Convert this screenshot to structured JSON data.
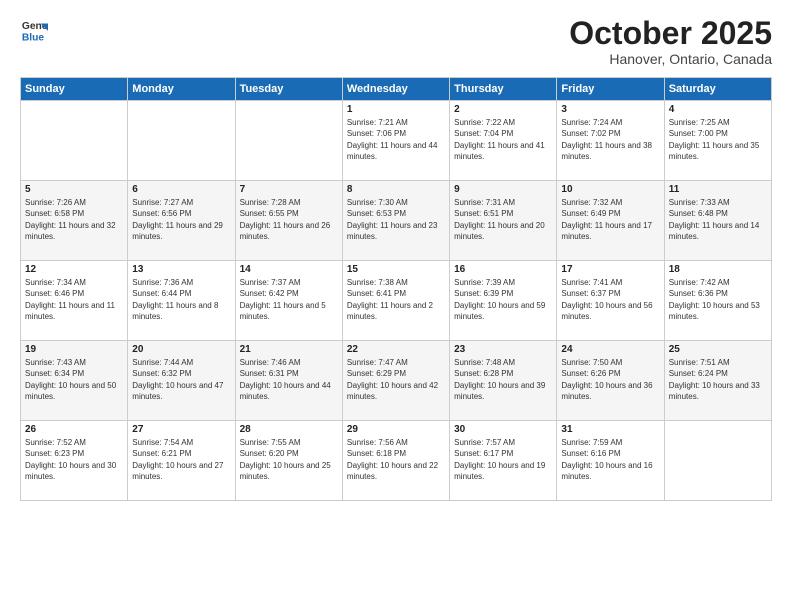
{
  "logo": {
    "line1": "General",
    "line2": "Blue"
  },
  "title": "October 2025",
  "location": "Hanover, Ontario, Canada",
  "days_of_week": [
    "Sunday",
    "Monday",
    "Tuesday",
    "Wednesday",
    "Thursday",
    "Friday",
    "Saturday"
  ],
  "weeks": [
    [
      {
        "day": "",
        "sunrise": "",
        "sunset": "",
        "daylight": ""
      },
      {
        "day": "",
        "sunrise": "",
        "sunset": "",
        "daylight": ""
      },
      {
        "day": "",
        "sunrise": "",
        "sunset": "",
        "daylight": ""
      },
      {
        "day": "1",
        "sunrise": "Sunrise: 7:21 AM",
        "sunset": "Sunset: 7:06 PM",
        "daylight": "Daylight: 11 hours and 44 minutes."
      },
      {
        "day": "2",
        "sunrise": "Sunrise: 7:22 AM",
        "sunset": "Sunset: 7:04 PM",
        "daylight": "Daylight: 11 hours and 41 minutes."
      },
      {
        "day": "3",
        "sunrise": "Sunrise: 7:24 AM",
        "sunset": "Sunset: 7:02 PM",
        "daylight": "Daylight: 11 hours and 38 minutes."
      },
      {
        "day": "4",
        "sunrise": "Sunrise: 7:25 AM",
        "sunset": "Sunset: 7:00 PM",
        "daylight": "Daylight: 11 hours and 35 minutes."
      }
    ],
    [
      {
        "day": "5",
        "sunrise": "Sunrise: 7:26 AM",
        "sunset": "Sunset: 6:58 PM",
        "daylight": "Daylight: 11 hours and 32 minutes."
      },
      {
        "day": "6",
        "sunrise": "Sunrise: 7:27 AM",
        "sunset": "Sunset: 6:56 PM",
        "daylight": "Daylight: 11 hours and 29 minutes."
      },
      {
        "day": "7",
        "sunrise": "Sunrise: 7:28 AM",
        "sunset": "Sunset: 6:55 PM",
        "daylight": "Daylight: 11 hours and 26 minutes."
      },
      {
        "day": "8",
        "sunrise": "Sunrise: 7:30 AM",
        "sunset": "Sunset: 6:53 PM",
        "daylight": "Daylight: 11 hours and 23 minutes."
      },
      {
        "day": "9",
        "sunrise": "Sunrise: 7:31 AM",
        "sunset": "Sunset: 6:51 PM",
        "daylight": "Daylight: 11 hours and 20 minutes."
      },
      {
        "day": "10",
        "sunrise": "Sunrise: 7:32 AM",
        "sunset": "Sunset: 6:49 PM",
        "daylight": "Daylight: 11 hours and 17 minutes."
      },
      {
        "day": "11",
        "sunrise": "Sunrise: 7:33 AM",
        "sunset": "Sunset: 6:48 PM",
        "daylight": "Daylight: 11 hours and 14 minutes."
      }
    ],
    [
      {
        "day": "12",
        "sunrise": "Sunrise: 7:34 AM",
        "sunset": "Sunset: 6:46 PM",
        "daylight": "Daylight: 11 hours and 11 minutes."
      },
      {
        "day": "13",
        "sunrise": "Sunrise: 7:36 AM",
        "sunset": "Sunset: 6:44 PM",
        "daylight": "Daylight: 11 hours and 8 minutes."
      },
      {
        "day": "14",
        "sunrise": "Sunrise: 7:37 AM",
        "sunset": "Sunset: 6:42 PM",
        "daylight": "Daylight: 11 hours and 5 minutes."
      },
      {
        "day": "15",
        "sunrise": "Sunrise: 7:38 AM",
        "sunset": "Sunset: 6:41 PM",
        "daylight": "Daylight: 11 hours and 2 minutes."
      },
      {
        "day": "16",
        "sunrise": "Sunrise: 7:39 AM",
        "sunset": "Sunset: 6:39 PM",
        "daylight": "Daylight: 10 hours and 59 minutes."
      },
      {
        "day": "17",
        "sunrise": "Sunrise: 7:41 AM",
        "sunset": "Sunset: 6:37 PM",
        "daylight": "Daylight: 10 hours and 56 minutes."
      },
      {
        "day": "18",
        "sunrise": "Sunrise: 7:42 AM",
        "sunset": "Sunset: 6:36 PM",
        "daylight": "Daylight: 10 hours and 53 minutes."
      }
    ],
    [
      {
        "day": "19",
        "sunrise": "Sunrise: 7:43 AM",
        "sunset": "Sunset: 6:34 PM",
        "daylight": "Daylight: 10 hours and 50 minutes."
      },
      {
        "day": "20",
        "sunrise": "Sunrise: 7:44 AM",
        "sunset": "Sunset: 6:32 PM",
        "daylight": "Daylight: 10 hours and 47 minutes."
      },
      {
        "day": "21",
        "sunrise": "Sunrise: 7:46 AM",
        "sunset": "Sunset: 6:31 PM",
        "daylight": "Daylight: 10 hours and 44 minutes."
      },
      {
        "day": "22",
        "sunrise": "Sunrise: 7:47 AM",
        "sunset": "Sunset: 6:29 PM",
        "daylight": "Daylight: 10 hours and 42 minutes."
      },
      {
        "day": "23",
        "sunrise": "Sunrise: 7:48 AM",
        "sunset": "Sunset: 6:28 PM",
        "daylight": "Daylight: 10 hours and 39 minutes."
      },
      {
        "day": "24",
        "sunrise": "Sunrise: 7:50 AM",
        "sunset": "Sunset: 6:26 PM",
        "daylight": "Daylight: 10 hours and 36 minutes."
      },
      {
        "day": "25",
        "sunrise": "Sunrise: 7:51 AM",
        "sunset": "Sunset: 6:24 PM",
        "daylight": "Daylight: 10 hours and 33 minutes."
      }
    ],
    [
      {
        "day": "26",
        "sunrise": "Sunrise: 7:52 AM",
        "sunset": "Sunset: 6:23 PM",
        "daylight": "Daylight: 10 hours and 30 minutes."
      },
      {
        "day": "27",
        "sunrise": "Sunrise: 7:54 AM",
        "sunset": "Sunset: 6:21 PM",
        "daylight": "Daylight: 10 hours and 27 minutes."
      },
      {
        "day": "28",
        "sunrise": "Sunrise: 7:55 AM",
        "sunset": "Sunset: 6:20 PM",
        "daylight": "Daylight: 10 hours and 25 minutes."
      },
      {
        "day": "29",
        "sunrise": "Sunrise: 7:56 AM",
        "sunset": "Sunset: 6:18 PM",
        "daylight": "Daylight: 10 hours and 22 minutes."
      },
      {
        "day": "30",
        "sunrise": "Sunrise: 7:57 AM",
        "sunset": "Sunset: 6:17 PM",
        "daylight": "Daylight: 10 hours and 19 minutes."
      },
      {
        "day": "31",
        "sunrise": "Sunrise: 7:59 AM",
        "sunset": "Sunset: 6:16 PM",
        "daylight": "Daylight: 10 hours and 16 minutes."
      },
      {
        "day": "",
        "sunrise": "",
        "sunset": "",
        "daylight": ""
      }
    ]
  ]
}
